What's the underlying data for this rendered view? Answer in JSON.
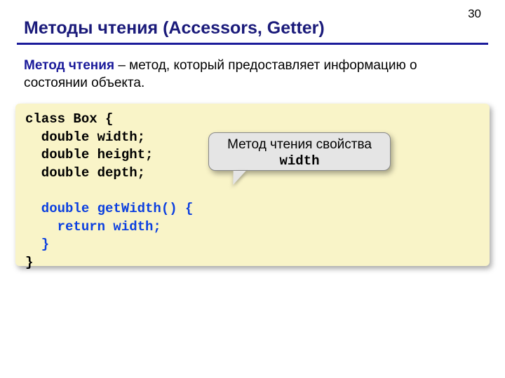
{
  "page_number": "30",
  "title": "Методы чтения (Accessors, Getter)",
  "definition": {
    "term": "Метод чтения",
    "rest": " – метод, который предоставляет информацию о состоянии объекта."
  },
  "code": {
    "l1a": "class Box {",
    "l2a": "  double width;",
    "l3a": "  double height;",
    "l4a": "  double depth;",
    "blank": " ",
    "l6a": "  double getWidth() {",
    "l7a": "    return width;",
    "l8a": "  }",
    "l9a": "}"
  },
  "callout": {
    "line1": "Метод чтения свойства",
    "prop": "width"
  }
}
